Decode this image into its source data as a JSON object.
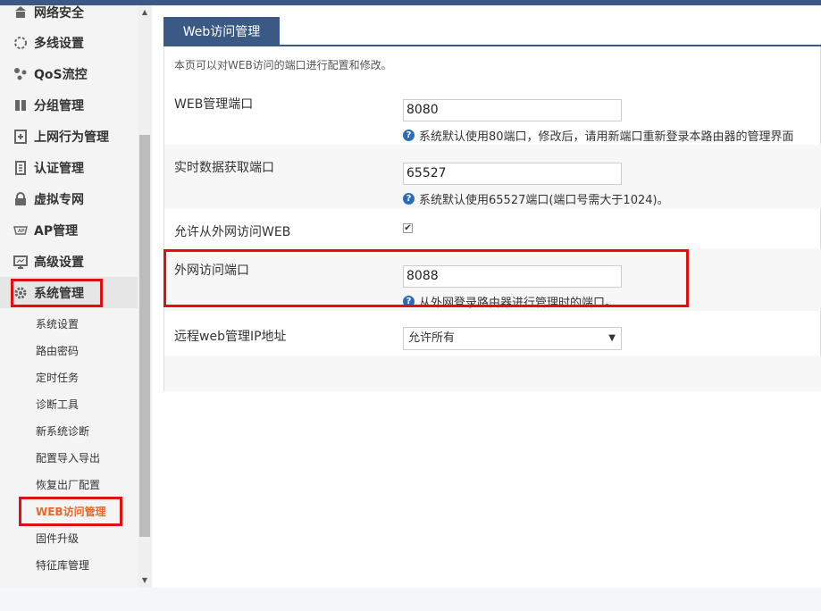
{
  "sidebar": {
    "items": [
      {
        "label": "网络安全",
        "icon": "network-security-icon"
      },
      {
        "label": "多线设置",
        "icon": "multiline-icon"
      },
      {
        "label": "QoS流控",
        "icon": "qos-icon"
      },
      {
        "label": "分组管理",
        "icon": "group-icon"
      },
      {
        "label": "上网行为管理",
        "icon": "behavior-icon"
      },
      {
        "label": "认证管理",
        "icon": "auth-icon"
      },
      {
        "label": "虚拟专网",
        "icon": "vpn-lock-icon"
      },
      {
        "label": "AP管理",
        "icon": "ap-icon"
      },
      {
        "label": "高级设置",
        "icon": "monitor-icon"
      },
      {
        "label": "系统管理",
        "icon": "gear-icon"
      }
    ],
    "sub_items": [
      {
        "label": "系统设置"
      },
      {
        "label": "路由密码"
      },
      {
        "label": "定时任务"
      },
      {
        "label": "诊断工具"
      },
      {
        "label": "新系统诊断"
      },
      {
        "label": "配置导入导出"
      },
      {
        "label": "恢复出厂配置"
      },
      {
        "label": "WEB访问管理"
      },
      {
        "label": "固件升级"
      },
      {
        "label": "特征库管理"
      }
    ]
  },
  "main": {
    "tab_label": "Web访问管理",
    "description": "本页可以对WEB访问的端口进行配置和修改。",
    "fields": {
      "web_port": {
        "label": "WEB管理端口",
        "value": "8080",
        "hint": "系统默认使用80端口，修改后，请用新端口重新登录本路由器的管理界面"
      },
      "realtime_port": {
        "label": "实时数据获取端口",
        "value": "65527",
        "hint": "系统默认使用65527端口(端口号需大于1024)。"
      },
      "allow_wan": {
        "label": "允许从外网访问WEB",
        "checked": true
      },
      "wan_port": {
        "label": "外网访问端口",
        "value": "8088",
        "hint": "从外网登录路由器进行管理时的端口。"
      },
      "remote_ip": {
        "label": "远程web管理IP地址",
        "selected": "允许所有"
      }
    }
  },
  "colors": {
    "accent": "#3a5a85",
    "highlight": "#e01010",
    "active_sub": "#e8682a"
  }
}
